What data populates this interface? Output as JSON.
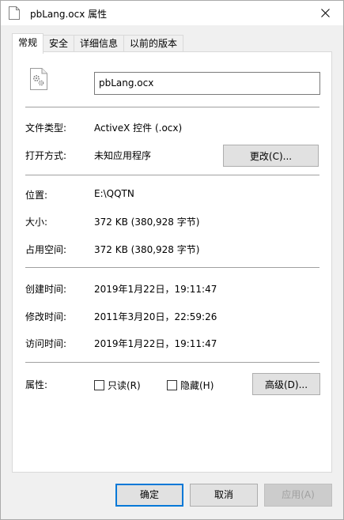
{
  "window": {
    "title": "pbLang.ocx 属性",
    "close_glyph": "✕"
  },
  "tabs": [
    {
      "label": "常规",
      "active": true
    },
    {
      "label": "安全",
      "active": false
    },
    {
      "label": "详细信息",
      "active": false
    },
    {
      "label": "以前的版本",
      "active": false
    }
  ],
  "general": {
    "file_name": "pbLang.ocx",
    "file_type_label": "文件类型:",
    "file_type_value": "ActiveX 控件 (.ocx)",
    "open_with_label": "打开方式:",
    "open_with_value": "未知应用程序",
    "change_button": "更改(C)...",
    "location_label": "位置:",
    "location_value": "E:\\QQTN",
    "size_label": "大小:",
    "size_value": "372 KB (380,928 字节)",
    "size_on_disk_label": "占用空间:",
    "size_on_disk_value": "372 KB (380,928 字节)",
    "created_label": "创建时间:",
    "created_value": "2019年1月22日，19:11:47",
    "modified_label": "修改时间:",
    "modified_value": "2011年3月20日，22:59:26",
    "accessed_label": "访问时间:",
    "accessed_value": "2019年1月22日，19:11:47",
    "attributes_label": "属性:",
    "readonly_label": "只读(R)",
    "readonly_checked": false,
    "hidden_label": "隐藏(H)",
    "hidden_checked": false,
    "advanced_button": "高级(D)..."
  },
  "footer": {
    "ok": "确定",
    "cancel": "取消",
    "apply": "应用(A)"
  },
  "colors": {
    "accent": "#0078d7",
    "button_face": "#e1e1e1",
    "window_bg": "#f0f0f0"
  }
}
